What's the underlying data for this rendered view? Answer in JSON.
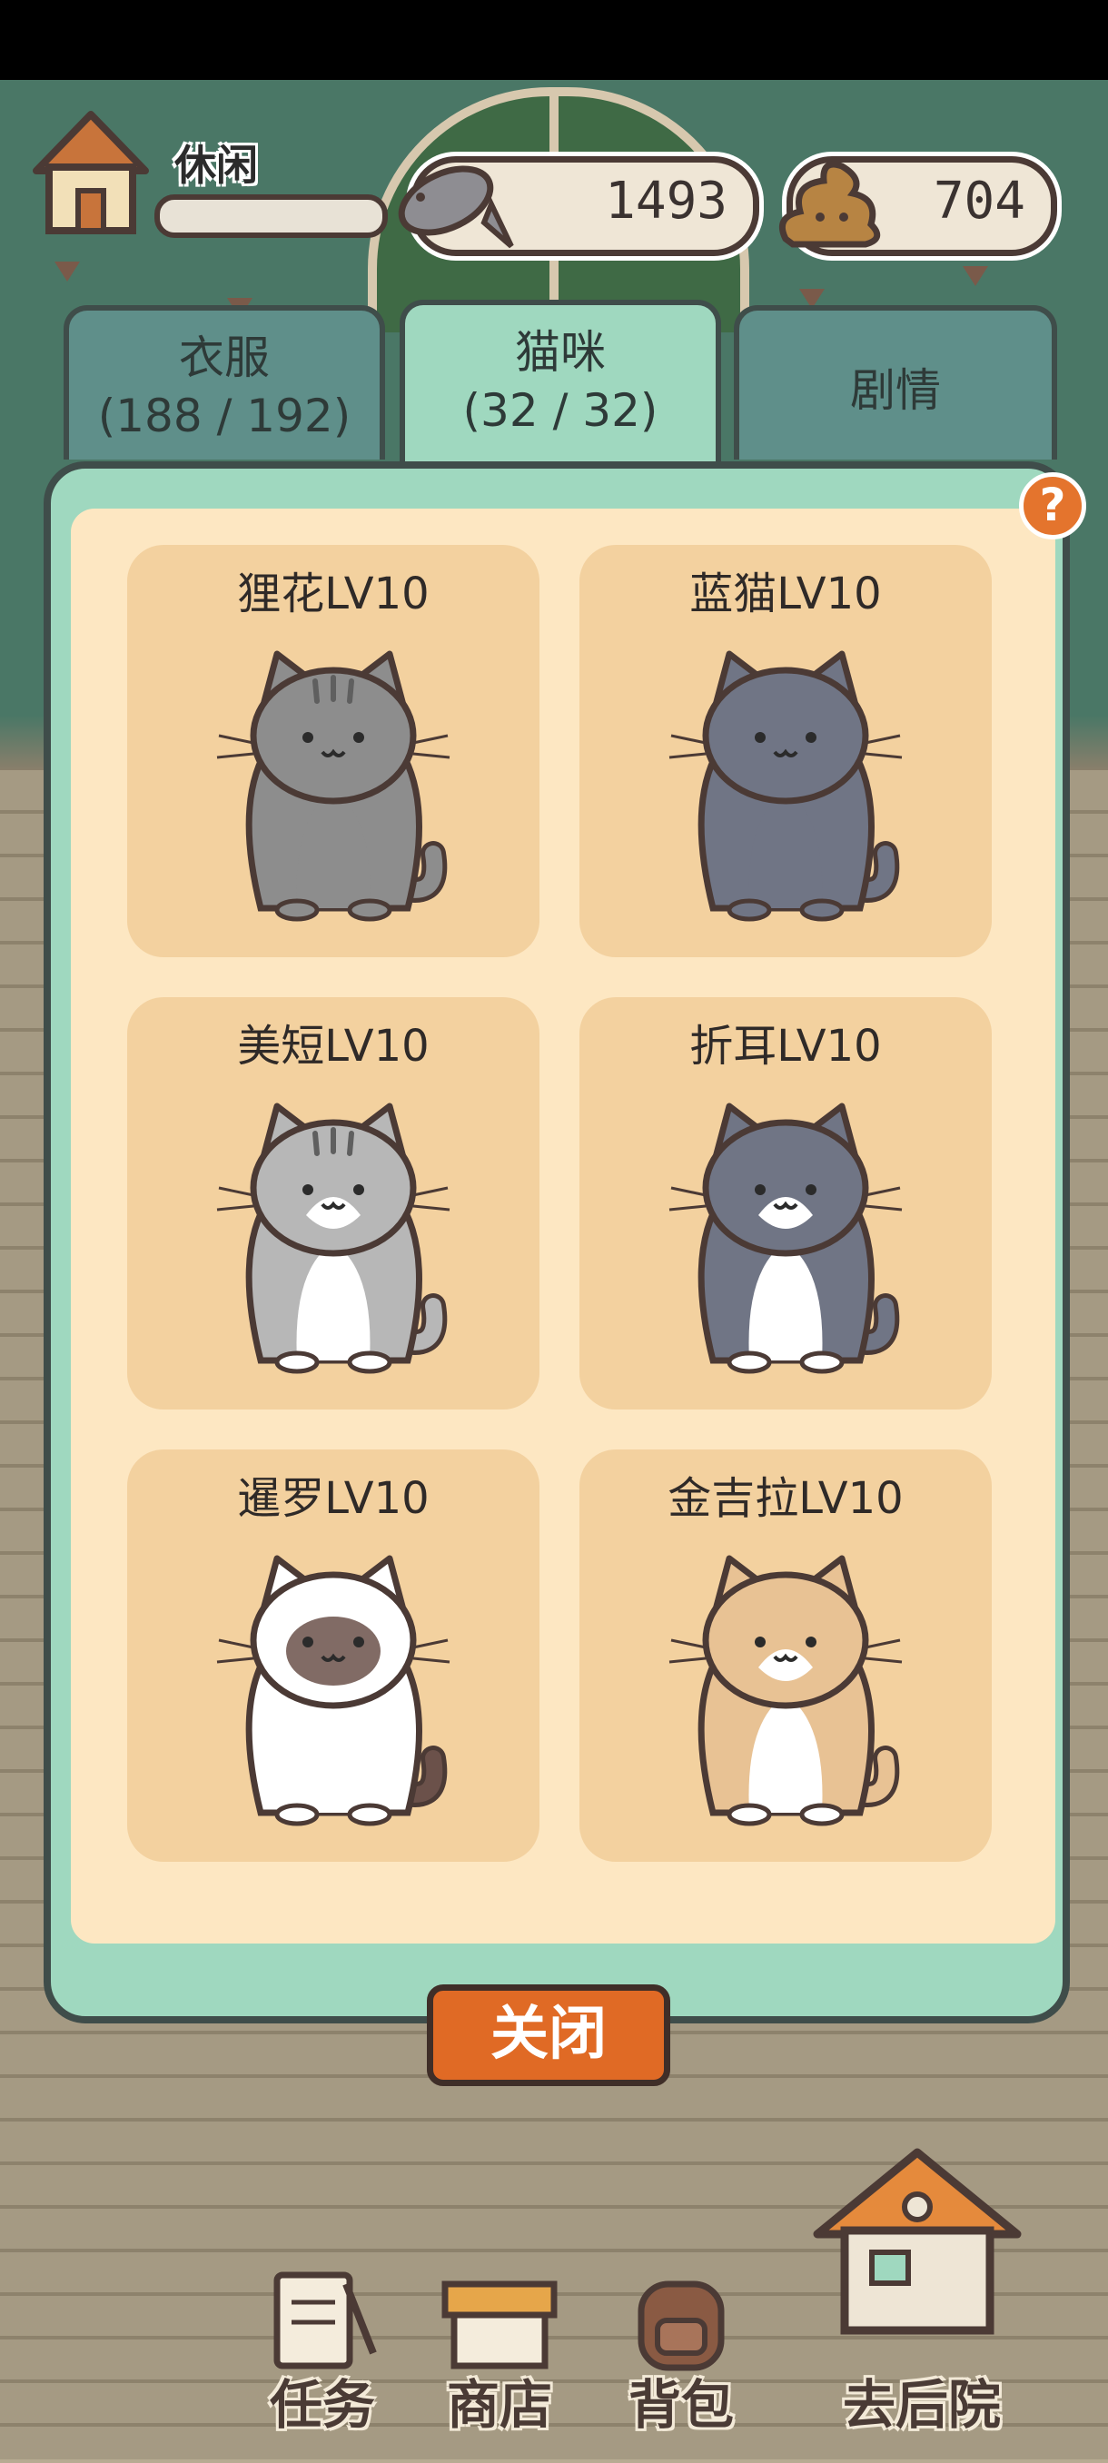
{
  "hud": {
    "status_label": "休闲",
    "fish_amount": "1493",
    "poop_amount": "704",
    "mood_level": 0
  },
  "tabs": [
    {
      "label": "衣服",
      "count": "(188 / 192)",
      "active": false
    },
    {
      "label": "猫咪",
      "count": "(32 / 32)",
      "active": true
    },
    {
      "label": "剧情",
      "count": "",
      "active": false
    }
  ],
  "help_label": "?",
  "cats": [
    {
      "name": "狸花LV10",
      "body": "#8d8d8d",
      "belly": "#8d8d8d",
      "stripes": true,
      "icon": "tabby-cat-icon"
    },
    {
      "name": "蓝猫LV10",
      "body": "#707585",
      "belly": "#707585",
      "stripes": false,
      "icon": "blue-cat-icon"
    },
    {
      "name": "美短LV10",
      "body": "#b7b7b7",
      "belly": "#ffffff",
      "stripes": true,
      "icon": "shorthair-cat-icon"
    },
    {
      "name": "折耳LV10",
      "body": "#707585",
      "belly": "#ffffff",
      "stripes": false,
      "icon": "fold-cat-icon"
    },
    {
      "name": "暹罗LV10",
      "body": "#ffffff",
      "belly": "#ffffff",
      "stripes": false,
      "icon": "siamese-cat-icon",
      "mask": "#6b514a",
      "tail": "#6b514a"
    },
    {
      "name": "金吉拉LV10",
      "body": "#e8c294",
      "belly": "#ffffff",
      "stripes": false,
      "icon": "chinchilla-cat-icon"
    }
  ],
  "close_label": "关闭",
  "nav": [
    {
      "label": "任务",
      "icon": "task-icon"
    },
    {
      "label": "商店",
      "icon": "shop-icon"
    },
    {
      "label": "背包",
      "icon": "backpack-icon"
    },
    {
      "label": "去后院",
      "icon": "backyard-house-icon"
    }
  ],
  "colors": {
    "accent": "#e06a25",
    "panel": "#9fd8bf",
    "card": "#f3d19f",
    "outline": "#4b3a35"
  }
}
